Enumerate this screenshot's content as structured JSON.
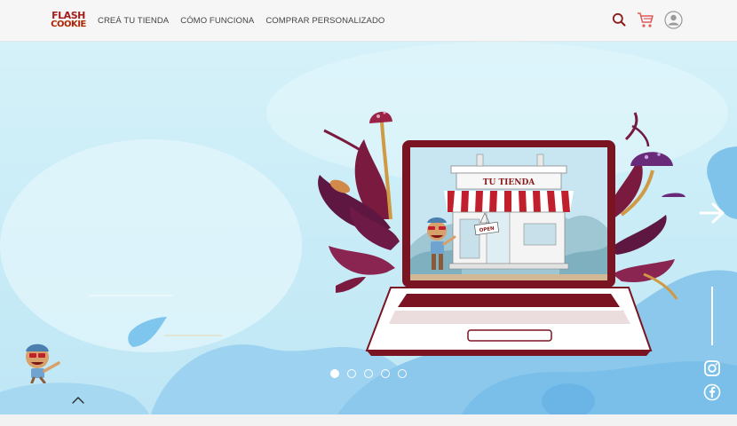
{
  "brand": {
    "line1": "FLASH",
    "line2": "COOKIE"
  },
  "nav": {
    "items": [
      {
        "label": "CREÁ TU TIENDA"
      },
      {
        "label": "CÓMO FUNCIONA"
      },
      {
        "label": "COMPRAR PERSONALIZADO"
      }
    ]
  },
  "header_icons": [
    "search-icon",
    "cart-icon",
    "user-icon"
  ],
  "hero": {
    "sign": "TU TIENDA",
    "door_sign": "OPEN",
    "slides_total": 5,
    "active_slide": 1
  },
  "social": [
    "instagram-icon",
    "facebook-icon"
  ],
  "colors": {
    "brand_red": "#a51c1c",
    "sky": "#cbeef8",
    "blob_blue": "#8cc8ec",
    "laptop_frame": "#7a1423",
    "plant_purple": "#6a1c4e"
  }
}
